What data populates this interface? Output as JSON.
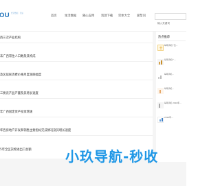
{
  "header": {
    "logo_text": "OU",
    "logo_subtext": "经济数据 · 知识",
    "nav": [
      {
        "label": "首页"
      },
      {
        "label": "生活数据"
      },
      {
        "label": "随心应用"
      },
      {
        "label": "资源下载"
      },
      {
        "label": "完体大全"
      },
      {
        "label": "爱帮问"
      }
    ],
    "search_placeholder": "输入关键词"
  },
  "articles": [
    {
      "title": "西三次产业结构"
    },
    {
      "title": "末广西常住人口数及其构成"
    },
    {
      "title": "及区居民消费价格月度涨跌幅度"
    },
    {
      "title": "三要农产品产量及其增长速度"
    },
    {
      "title": "年广西固定资产投资增速"
    },
    {
      "title": "年西房地产开发和销售主要指标完成情况及其增长速度"
    },
    {
      "title": "5年全区货物进出口总额"
    }
  ],
  "sidebar": {
    "title": "热点推荐",
    "items": [
      {
        "text": "每年手机广告..."
      },
      {
        "text": "每年手机广..."
      },
      {
        "text": "每年手机..."
      },
      {
        "text": "每年手机..."
      },
      {
        "text": "每年手机 2016年..."
      },
      {
        "text": "2016年..."
      }
    ]
  },
  "watermark": {
    "text": "小玖导航-秒收"
  },
  "colors": {
    "accent": "#1f97e6",
    "logo": "#1a6fb8"
  }
}
